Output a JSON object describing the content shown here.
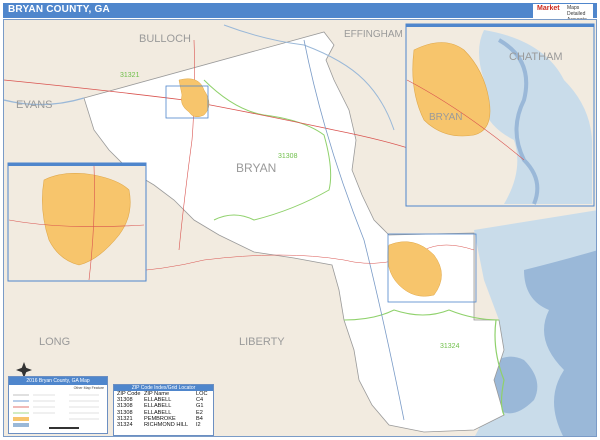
{
  "header": {
    "title": "BRYAN COUNTY, GA",
    "brand_line1": "Market",
    "brand_line2": "Maps",
    "brand_small": "Detailed Accurate Reliable"
  },
  "map": {
    "colors": {
      "land": "#f2ebe0",
      "county": "#ffffff",
      "water": "#9ab8d8",
      "urban": "#f7c56c",
      "zip_boundary": "#8fd16b",
      "road_red": "#d9534f",
      "border_blue": "#4f86cc"
    },
    "labels": {
      "bulloch": "BULLOCH",
      "effingham": "EFFINGHAM",
      "chatham": "CHATHAM",
      "evans": "EVANS",
      "bryan": "BRYAN",
      "long": "LONG",
      "liberty": "LIBERTY",
      "inset_bryan": "BRYAN"
    },
    "zip_labels": {
      "z31321": "31321",
      "z31308": "31308",
      "z31324": "31324"
    }
  },
  "legend": {
    "title": "2016 Bryan County, GA Map",
    "subtitle": "Other Map Feature"
  },
  "zip_index": {
    "title": "ZIP Code Index/Grid Locator",
    "columns": [
      "ZIP Code",
      "ZIP Name",
      "LOC"
    ],
    "rows": [
      {
        "zip": "31308",
        "name": "ELLABELL",
        "loc": "C4"
      },
      {
        "zip": "31308",
        "name": "ELLABELL",
        "loc": "G1"
      },
      {
        "zip": "31308",
        "name": "ELLABELL",
        "loc": "E2"
      },
      {
        "zip": "31321",
        "name": "PEMBROKE",
        "loc": "B4"
      },
      {
        "zip": "31324",
        "name": "RICHMOND HILL",
        "loc": "I2"
      }
    ]
  }
}
